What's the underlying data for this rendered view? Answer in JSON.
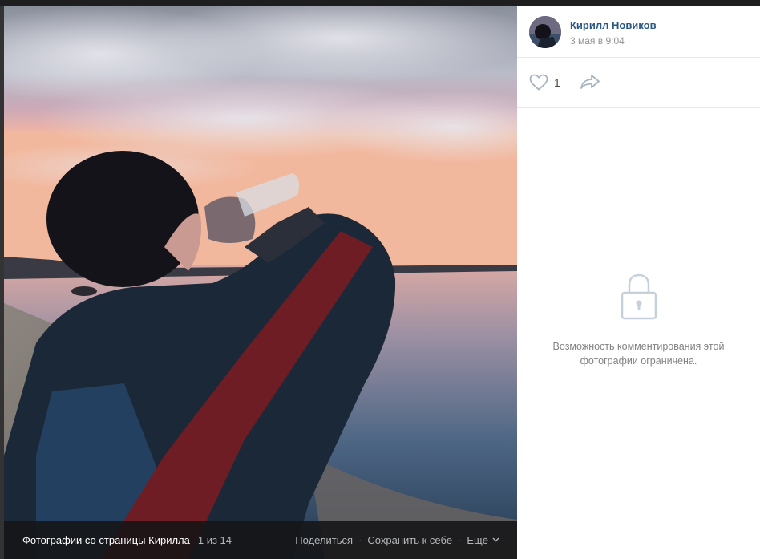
{
  "photo": {
    "bar_title": "Фотографии со страницы Кирилла",
    "counter": "1 из 14",
    "actions": {
      "share": "Поделиться",
      "save": "Сохранить к себе",
      "more": "Ещё"
    },
    "separator": "·"
  },
  "author": {
    "name": "Кирилл Новиков",
    "date": "3 мая в 9:04"
  },
  "reactions": {
    "like_count": "1",
    "icons": [
      "heart-icon",
      "share-arrow-icon"
    ]
  },
  "comments": {
    "restricted_text": "Возможность комментирования этой фотографии ограничена.",
    "icon": "lock-icon"
  },
  "colors": {
    "link": "#2a5885",
    "muted": "#939393",
    "icon": "#a8b4c2"
  }
}
